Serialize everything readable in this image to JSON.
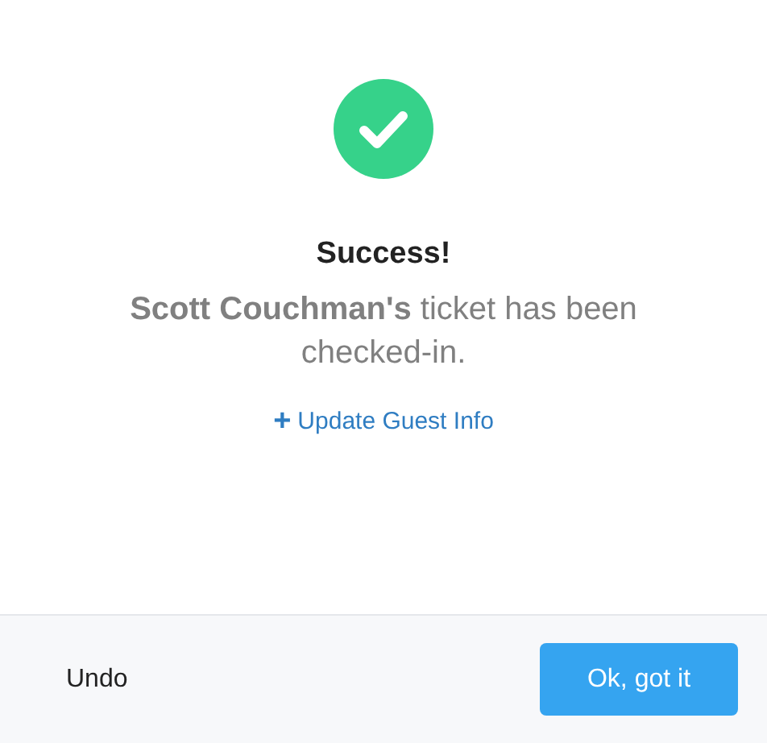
{
  "dialog": {
    "title": "Success!",
    "message": "**Scott Couchman's** ticket has been checked-in.",
    "link": {
      "icon": "+",
      "label": "Update Guest Info"
    }
  },
  "footer": {
    "buttons": [
      {
        "label": "Undo",
        "kind": "plain"
      },
      {
        "label": "Ok, got it",
        "kind": "primary"
      }
    ]
  }
}
